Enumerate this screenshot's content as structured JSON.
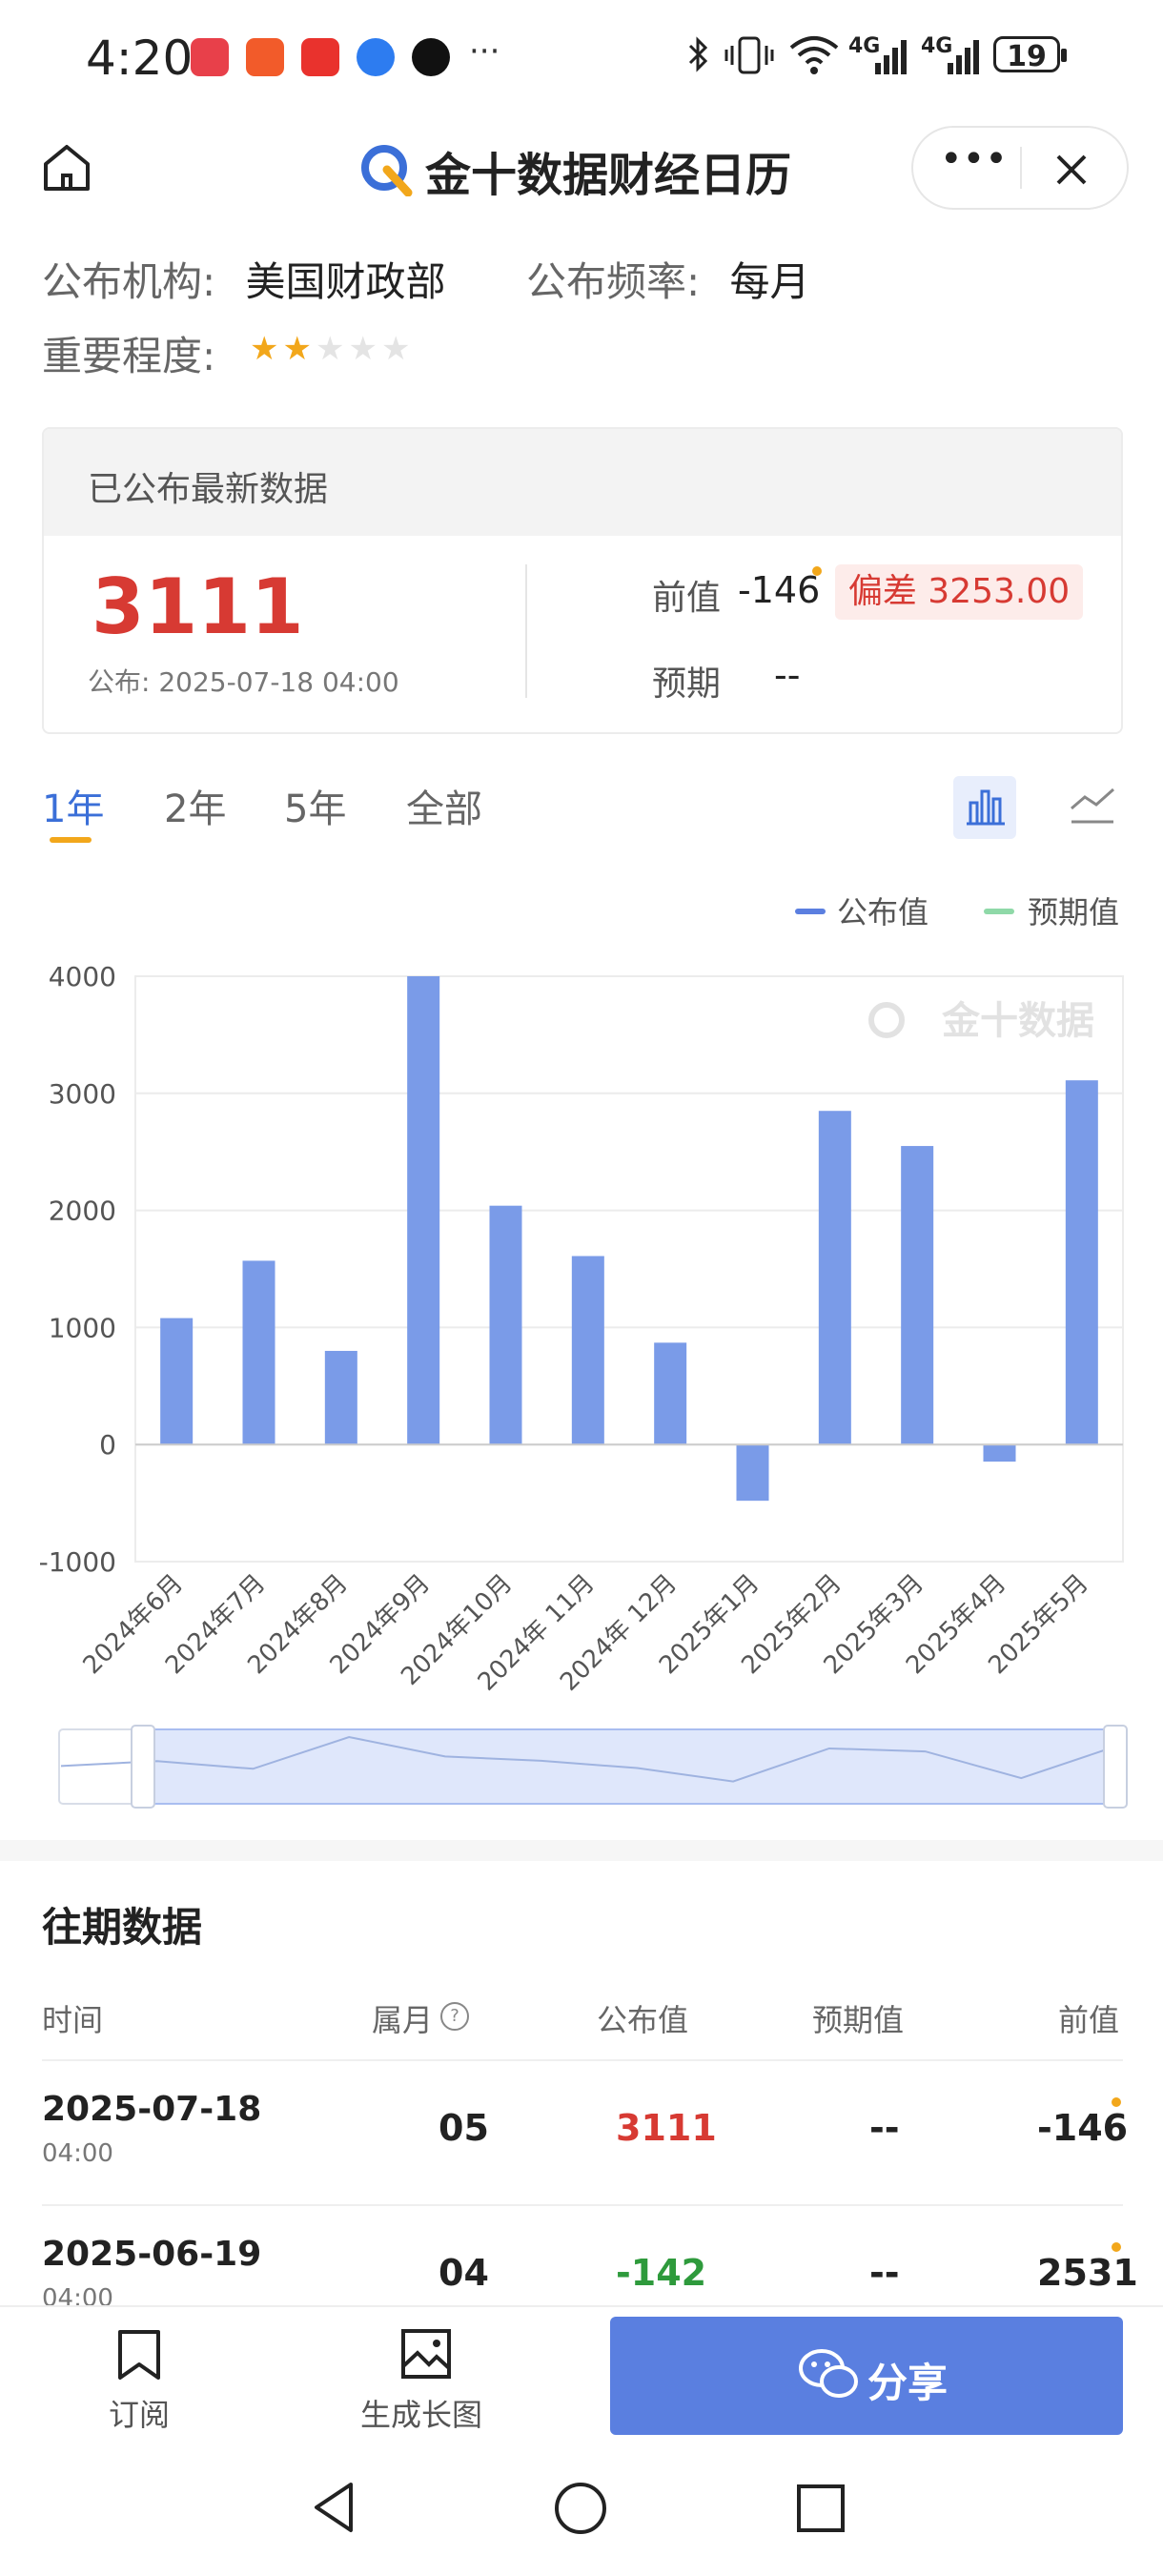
{
  "status_bar": {
    "time": "4:20",
    "battery": "19",
    "net1": "4G",
    "net2": "4G"
  },
  "nav": {
    "title": "金十数据财经日历"
  },
  "info": {
    "org_label": "公布机构:",
    "org_value": "美国财政部",
    "freq_label": "公布频率:",
    "freq_value": "每月",
    "importance_label": "重要程度:",
    "importance_stars": 2,
    "importance_max": 5
  },
  "card": {
    "header": "已公布最新数据",
    "actual": "3111",
    "published": "公布: 2025-07-18 04:00",
    "prev_label": "前值",
    "prev_value": "-146",
    "deviation_label": "偏差",
    "deviation_value": "3253.00",
    "forecast_label": "预期",
    "forecast_value": "--"
  },
  "tabs": [
    "1年",
    "2年",
    "5年",
    "全部"
  ],
  "active_tab": 0,
  "legend": [
    {
      "name": "公布值",
      "color": "#5b7fe0"
    },
    {
      "name": "预期值",
      "color": "#8fd9a8"
    }
  ],
  "watermark": "金十数据",
  "chart_data": {
    "type": "bar",
    "categories": [
      "2024年6月",
      "2024年7月",
      "2024年8月",
      "2024年9月",
      "2024年10月",
      "2024年 11月",
      "2024年 12月",
      "2025年1月",
      "2025年2月",
      "2025年3月",
      "2025年4月",
      "2025年5月"
    ],
    "series": [
      {
        "name": "公布值",
        "values": [
          1080,
          1570,
          800,
          4000,
          2040,
          1610,
          870,
          -480,
          2850,
          2550,
          -146,
          3111
        ]
      }
    ],
    "y_ticks": [
      "4000",
      "3000",
      "2000",
      "1000",
      "0",
      "-1000"
    ],
    "ylim": [
      -1000,
      4000
    ],
    "grid": true,
    "color": "#7a9be8"
  },
  "history": {
    "title": "往期数据",
    "headers": [
      "时间",
      "属月",
      "公布值",
      "预期值",
      "前值"
    ],
    "rows": [
      {
        "date": "2025-07-18",
        "time": "04:00",
        "month": "05",
        "actual": "3111",
        "actual_color": "#d73a33",
        "forecast": "--",
        "prev": "-146"
      },
      {
        "date": "2025-06-19",
        "time": "04:00",
        "month": "04",
        "actual": "-142",
        "actual_color": "#2e9a3c",
        "forecast": "--",
        "prev": "2531"
      }
    ]
  },
  "bottom": {
    "subscribe": "订阅",
    "long_image": "生成长图",
    "share": "分享"
  }
}
